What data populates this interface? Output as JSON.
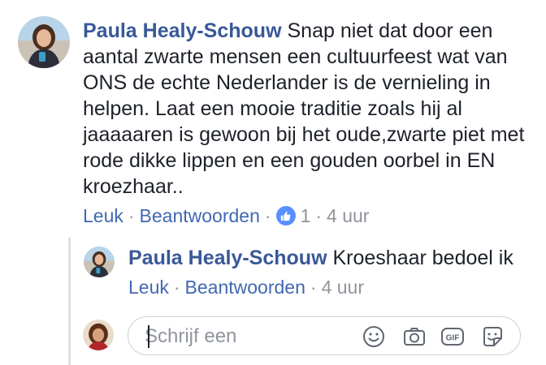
{
  "comment": {
    "author": "Paula Healy-Schouw",
    "text": "Snap niet dat door een aantal zwarte mensen een cultuurfeest wat van ONS de echte Nederlander is de vernieling in helpen. Laat een mooie traditie zoals hij al jaaaaaren is gewoon bij het oude,zwarte piet met rode dikke lippen en een gouden oorbel in EN kroezhaar..",
    "actions": {
      "like": "Leuk",
      "reply": "Beantwoorden",
      "separator": "·"
    },
    "reaction_count": "1",
    "time": "4 uur",
    "reaction_icon": "thumbs-up-icon",
    "reaction_color": "#5890ff"
  },
  "reply": {
    "author": "Paula Healy-Schouw",
    "text": "Kroeshaar bedoel ik",
    "actions": {
      "like": "Leuk",
      "reply": "Beantwoorden",
      "separator": "·"
    },
    "time": "4 uur"
  },
  "composer": {
    "placeholder": "Schrijf een",
    "tools": [
      "emoji-icon",
      "camera-icon",
      "gif-icon",
      "sticker-icon"
    ],
    "gif_label": "GIF"
  },
  "colors": {
    "link": "#385898",
    "action": "#4267b2",
    "muted": "#90949c"
  }
}
